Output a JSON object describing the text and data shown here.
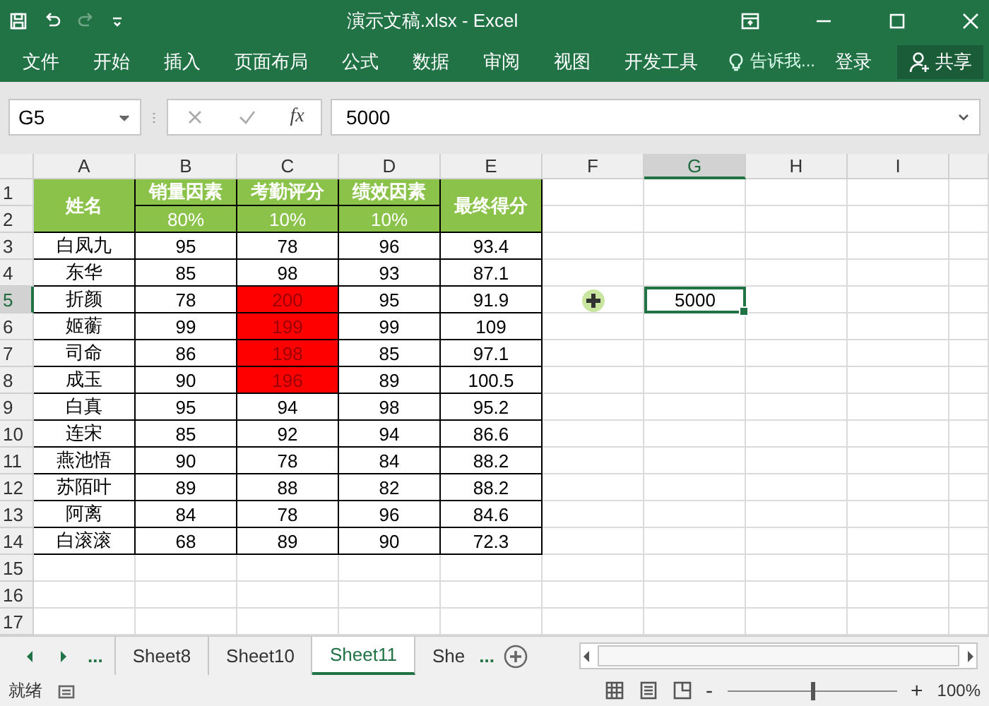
{
  "window": {
    "title": "演示文稿.xlsx - Excel"
  },
  "ribbon_tabs": [
    {
      "label": "文件"
    },
    {
      "label": "开始"
    },
    {
      "label": "插入"
    },
    {
      "label": "页面布局"
    },
    {
      "label": "公式"
    },
    {
      "label": "数据"
    },
    {
      "label": "审阅"
    },
    {
      "label": "视图"
    },
    {
      "label": "开发工具"
    }
  ],
  "tell_me": "告诉我...",
  "sign_in": "登录",
  "share": "共享",
  "name_box": "G5",
  "fx_label": "fx",
  "formula": "5000",
  "column_headers": [
    {
      "label": "A",
      "selected": false
    },
    {
      "label": "B",
      "selected": false
    },
    {
      "label": "C",
      "selected": false
    },
    {
      "label": "D",
      "selected": false
    },
    {
      "label": "E",
      "selected": false
    },
    {
      "label": "F",
      "selected": false
    },
    {
      "label": "G",
      "selected": true
    },
    {
      "label": "H",
      "selected": false
    },
    {
      "label": "I",
      "selected": false
    }
  ],
  "row_headers": [
    {
      "label": "1",
      "selected": false
    },
    {
      "label": "2",
      "selected": false
    },
    {
      "label": "3",
      "selected": false
    },
    {
      "label": "4",
      "selected": false
    },
    {
      "label": "5",
      "selected": true
    },
    {
      "label": "6",
      "selected": false
    },
    {
      "label": "7",
      "selected": false
    },
    {
      "label": "8",
      "selected": false
    },
    {
      "label": "9",
      "selected": false
    },
    {
      "label": "10",
      "selected": false
    },
    {
      "label": "11",
      "selected": false
    },
    {
      "label": "12",
      "selected": false
    },
    {
      "label": "13",
      "selected": false
    },
    {
      "label": "14",
      "selected": false
    },
    {
      "label": "15",
      "selected": false
    },
    {
      "label": "16",
      "selected": false
    },
    {
      "label": "17",
      "selected": false
    }
  ],
  "table": {
    "name_header": "姓名",
    "factors": [
      {
        "label": "销量因素",
        "weight": "80%"
      },
      {
        "label": "考勤评分",
        "weight": "10%"
      },
      {
        "label": "绩效因素",
        "weight": "10%"
      }
    ],
    "total_header": "最终得分",
    "rows": [
      {
        "name": "白凤九",
        "values": [
          {
            "text": "95",
            "highlighted": false
          },
          {
            "text": "78",
            "highlighted": false
          },
          {
            "text": "96",
            "highlighted": false
          }
        ],
        "total": "93.4"
      },
      {
        "name": "东华",
        "values": [
          {
            "text": "85",
            "highlighted": false
          },
          {
            "text": "98",
            "highlighted": false
          },
          {
            "text": "93",
            "highlighted": false
          }
        ],
        "total": "87.1"
      },
      {
        "name": "折颜",
        "values": [
          {
            "text": "78",
            "highlighted": false
          },
          {
            "text": "200",
            "highlighted": true
          },
          {
            "text": "95",
            "highlighted": false
          }
        ],
        "total": "91.9"
      },
      {
        "name": "姬蘅",
        "values": [
          {
            "text": "99",
            "highlighted": false
          },
          {
            "text": "199",
            "highlighted": true
          },
          {
            "text": "99",
            "highlighted": false
          }
        ],
        "total": "109"
      },
      {
        "name": "司命",
        "values": [
          {
            "text": "86",
            "highlighted": false
          },
          {
            "text": "198",
            "highlighted": true
          },
          {
            "text": "85",
            "highlighted": false
          }
        ],
        "total": "97.1"
      },
      {
        "name": "成玉",
        "values": [
          {
            "text": "90",
            "highlighted": false
          },
          {
            "text": "196",
            "highlighted": true
          },
          {
            "text": "89",
            "highlighted": false
          }
        ],
        "total": "100.5"
      },
      {
        "name": "白真",
        "values": [
          {
            "text": "95",
            "highlighted": false
          },
          {
            "text": "94",
            "highlighted": false
          },
          {
            "text": "98",
            "highlighted": false
          }
        ],
        "total": "95.2"
      },
      {
        "name": "连宋",
        "values": [
          {
            "text": "85",
            "highlighted": false
          },
          {
            "text": "92",
            "highlighted": false
          },
          {
            "text": "94",
            "highlighted": false
          }
        ],
        "total": "86.6"
      },
      {
        "name": "燕池悟",
        "values": [
          {
            "text": "90",
            "highlighted": false
          },
          {
            "text": "78",
            "highlighted": false
          },
          {
            "text": "84",
            "highlighted": false
          }
        ],
        "total": "88.2"
      },
      {
        "name": "苏陌叶",
        "values": [
          {
            "text": "89",
            "highlighted": false
          },
          {
            "text": "88",
            "highlighted": false
          },
          {
            "text": "82",
            "highlighted": false
          }
        ],
        "total": "88.2"
      },
      {
        "name": "阿离",
        "values": [
          {
            "text": "84",
            "highlighted": false
          },
          {
            "text": "78",
            "highlighted": false
          },
          {
            "text": "96",
            "highlighted": false
          }
        ],
        "total": "84.6"
      },
      {
        "name": "白滚滚",
        "values": [
          {
            "text": "68",
            "highlighted": false
          },
          {
            "text": "89",
            "highlighted": false
          },
          {
            "text": "90",
            "highlighted": false
          }
        ],
        "total": "72.3"
      }
    ]
  },
  "active_cell": {
    "value": "5000"
  },
  "sheet_nav": {
    "more_left": "...",
    "more_right": "..."
  },
  "sheet_tabs": [
    {
      "label": "Sheet8",
      "selected": false
    },
    {
      "label": "Sheet10",
      "selected": false
    },
    {
      "label": "Sheet11",
      "selected": true
    },
    {
      "label": "She",
      "selected": false
    }
  ],
  "status_bar": {
    "status": "就绪",
    "zoom_out": "-",
    "zoom_in": "+",
    "zoom_slider": {
      "level": 0.5
    },
    "zoom": "100%"
  }
}
